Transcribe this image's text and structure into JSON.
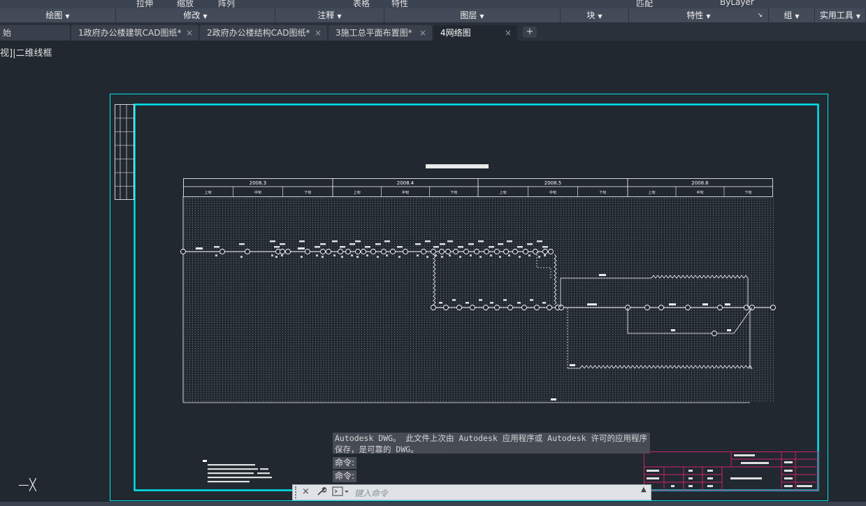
{
  "ribbon_top_fragments": [
    "拉伸",
    "缩放",
    "阵列",
    "表格",
    "特性",
    "匹配",
    "ByLayer"
  ],
  "panels": [
    {
      "label": "绘图",
      "dropdown": true
    },
    {
      "label": "修改",
      "dropdown": true
    },
    {
      "label": "注释",
      "dropdown": true
    },
    {
      "label": "图层",
      "dropdown": true
    },
    {
      "label": "块",
      "dropdown": true
    },
    {
      "label": "特性",
      "dropdown": true
    },
    {
      "label": "组",
      "dropdown": true
    },
    {
      "label": "实用工具",
      "dropdown": true
    }
  ],
  "tabs": [
    {
      "label": "始",
      "closable": false,
      "active": false
    },
    {
      "label": "1政府办公楼建筑CAD图纸*",
      "closable": true,
      "active": false
    },
    {
      "label": "2政府办公楼结构CAD图纸*",
      "closable": true,
      "active": false
    },
    {
      "label": "3施工总平面布置图*",
      "closable": true,
      "active": false
    },
    {
      "label": "4网络图",
      "closable": true,
      "active": true
    }
  ],
  "new_tab_symbol": "+",
  "close_symbol": "×",
  "viewport_label": "视]|二维线框",
  "drawing": {
    "months": [
      "2008.3",
      "2008.4",
      "2008.5",
      "2008.6"
    ],
    "decades": [
      "上旬",
      "中旬",
      "下旬"
    ]
  },
  "command_history": {
    "message": "Autodesk DWG。  此文件上次由 Autodesk 应用程序或 Autodesk 许可的应用程序保存，是可靠的 DWG。",
    "prompt_1": "命令:",
    "prompt_2": "命令:"
  },
  "command_input": {
    "placeholder": "键入命令",
    "close_icon": "×",
    "settings_icon": "wrench",
    "prompt_icon": "terminal"
  },
  "colors": {
    "background": "#212830",
    "cyan_frame": "#00e5ee",
    "linework": "#ffffff",
    "title_block": "#d0206a"
  }
}
